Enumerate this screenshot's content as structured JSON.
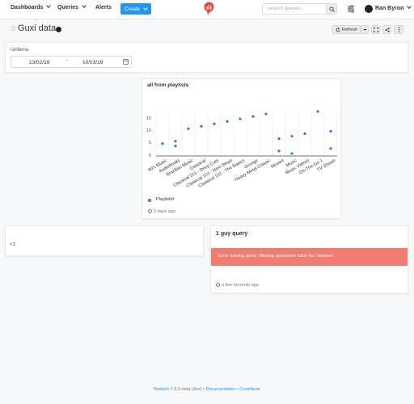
{
  "nav": {
    "dashboards": "Dashboards",
    "queries": "Queries",
    "alerts": "Alerts",
    "create": "Create",
    "search_placeholder": "Search queries...",
    "user_name": "Ran Byron"
  },
  "dashboard": {
    "title": "Guxi data",
    "refresh_label": "Refresh"
  },
  "parameter": {
    "label": "ranbena",
    "start_date": "13/02/19",
    "end_date": "10/03/19",
    "separator": "~"
  },
  "widgets": {
    "chart_title": "all from playlists",
    "chart_updated": "2 days ago",
    "text_content": "<3",
    "error_title": "1 guy query",
    "error_message": "Error running query: Missing parameter value for: ranbena",
    "error_updated": "a few seconds ago"
  },
  "chart_data": {
    "type": "scatter",
    "title": "all from playlists",
    "categories": [
      "90's Music",
      "Audiobooks",
      "Brazilian Music",
      "Classical",
      "Classical 101 - Deep Cuts",
      "Classical 101 - Next Steps",
      "Classical 101 - The Basics",
      "Grunge",
      "Heavy Metal Classic",
      "Movies",
      "Music",
      "Music Videos",
      "On-The-Go 1",
      "TV Shows"
    ],
    "series": [
      {
        "name": "PlaylistId",
        "points": [
          {
            "x": "90's Music",
            "y": 5
          },
          {
            "x": "Audiobooks",
            "y": 6
          },
          {
            "x": "Audiobooks",
            "y": 4
          },
          {
            "x": "Brazilian Music",
            "y": 11
          },
          {
            "x": "Classical",
            "y": 12
          },
          {
            "x": "Classical 101 - Deep Cuts",
            "y": 13
          },
          {
            "x": "Classical 101 - Next Steps",
            "y": 14
          },
          {
            "x": "Classical 101 - The Basics",
            "y": 15
          },
          {
            "x": "Grunge",
            "y": 16
          },
          {
            "x": "Heavy Metal Classic",
            "y": 17
          },
          {
            "x": "Movies",
            "y": 7
          },
          {
            "x": "Movies",
            "y": 2
          },
          {
            "x": "Music",
            "y": 8
          },
          {
            "x": "Music",
            "y": 1
          },
          {
            "x": "Music Videos",
            "y": 9
          },
          {
            "x": "On-The-Go 1",
            "y": 18
          },
          {
            "x": "TV Shows",
            "y": 10
          },
          {
            "x": "TV Shows",
            "y": 3
          }
        ]
      }
    ],
    "yticks": [
      "0",
      "5",
      "10",
      "15"
    ],
    "ylim": [
      0,
      18
    ],
    "legend_position": "bottom-left",
    "color": "#356aff"
  },
  "footer": {
    "app": "Redash",
    "version": "7.0.0-beta (dev)",
    "sep1": "•",
    "docs": "Documentation",
    "sep2": "•",
    "contribute": "Contribute"
  },
  "colors": {
    "primary": "#2196f3",
    "error": "#f27b72",
    "logo": "#e8473f",
    "series": "#356aff"
  }
}
